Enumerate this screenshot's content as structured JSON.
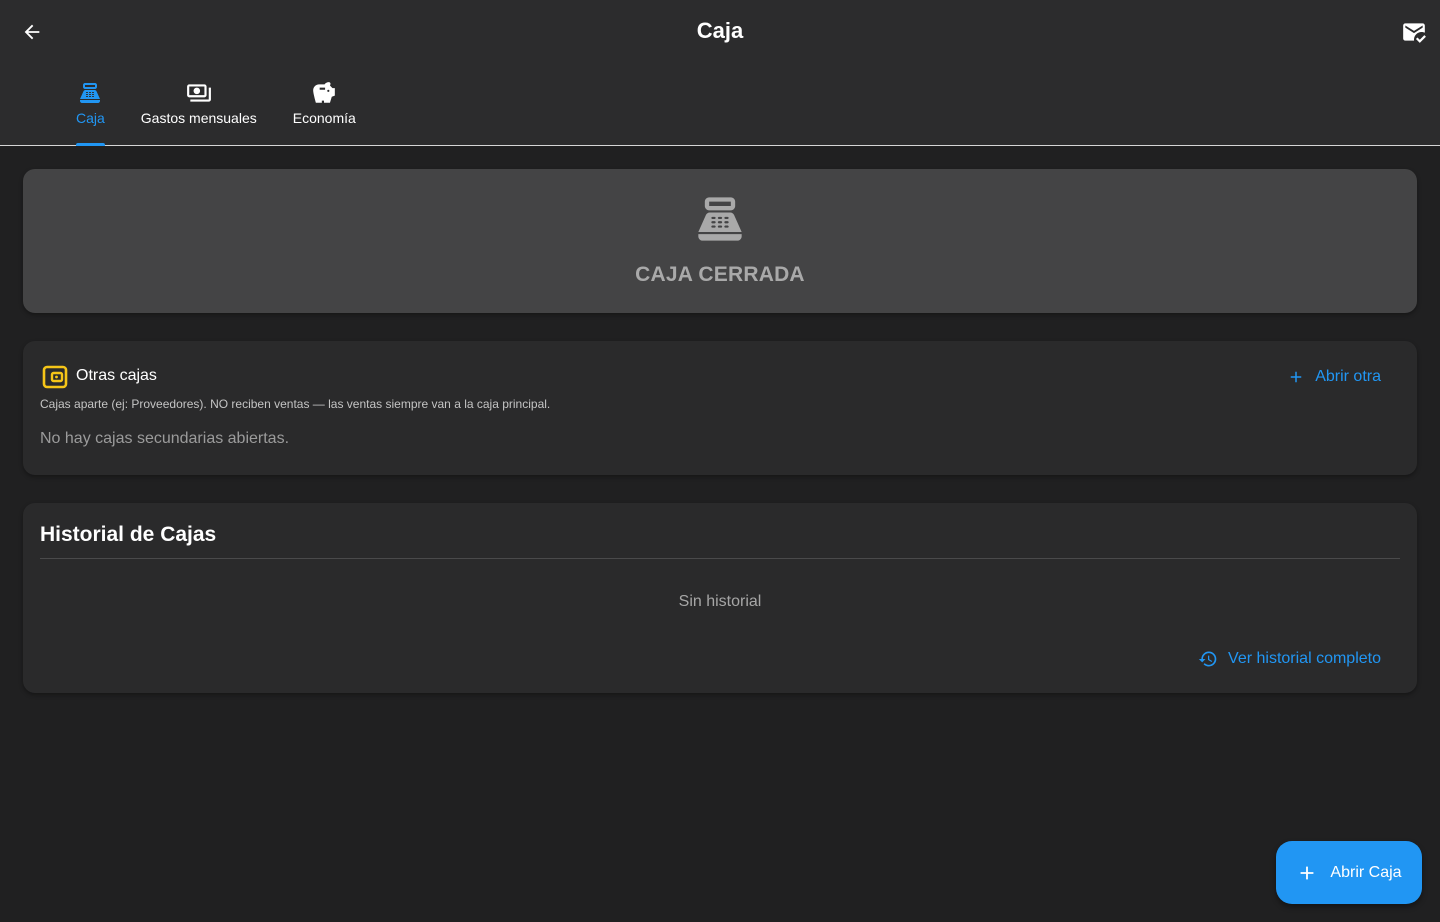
{
  "appbar": {
    "title": "Caja",
    "back_icon": "arrow-back-icon",
    "mail_icon": "mark-email-read-icon"
  },
  "tabs": [
    {
      "label": "Caja",
      "icon": "point-of-sale-icon",
      "active": true
    },
    {
      "label": "Gastos mensuales",
      "icon": "payments-icon",
      "active": false
    },
    {
      "label": "Economía",
      "icon": "savings-icon",
      "active": false
    }
  ],
  "status": {
    "icon": "point-of-sale-icon",
    "text": "CAJA CERRADA"
  },
  "other_boxes": {
    "icon": "wallet-icon",
    "title": "Otras cajas",
    "description": "Cajas aparte (ej: Proveedores). NO reciben ventas — las ventas siempre van a la caja principal.",
    "empty_text": "No hay cajas secundarias abiertas.",
    "open_other_label": "Abrir otra"
  },
  "history": {
    "title": "Historial de Cajas",
    "empty_text": "Sin historial",
    "view_all_label": "Ver historial completo"
  },
  "fab": {
    "label": "Abrir Caja"
  },
  "colors": {
    "accent": "#2196f3",
    "wallet": "#f5c518",
    "background": "#202021",
    "appbar": "#2c2c2d",
    "card": "#2a2a2b",
    "status_card": "#444445"
  }
}
